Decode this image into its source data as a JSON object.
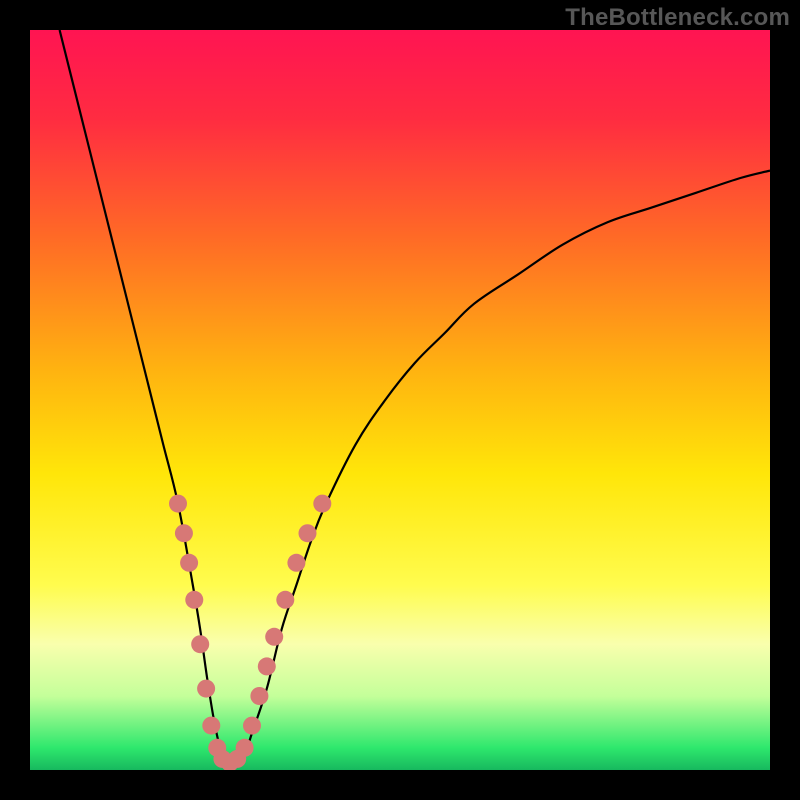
{
  "watermark": "TheBottleneck.com",
  "chart_data": {
    "type": "line",
    "title": "",
    "xlabel": "",
    "ylabel": "",
    "xlim": [
      0,
      100
    ],
    "ylim": [
      0,
      100
    ],
    "grid": false,
    "legend": false,
    "gradient_stops": [
      {
        "offset": 0.0,
        "color": "#ff1452"
      },
      {
        "offset": 0.12,
        "color": "#ff2c41"
      },
      {
        "offset": 0.28,
        "color": "#ff6a26"
      },
      {
        "offset": 0.46,
        "color": "#ffb310"
      },
      {
        "offset": 0.6,
        "color": "#ffe609"
      },
      {
        "offset": 0.75,
        "color": "#fffc4e"
      },
      {
        "offset": 0.83,
        "color": "#f9ffad"
      },
      {
        "offset": 0.9,
        "color": "#c4ff9a"
      },
      {
        "offset": 0.97,
        "color": "#2ee86d"
      },
      {
        "offset": 1.0,
        "color": "#17b85e"
      }
    ],
    "series": [
      {
        "name": "bottleneck-curve",
        "x": [
          4,
          6,
          8,
          10,
          12,
          14,
          16,
          18,
          20,
          22,
          23,
          24,
          25,
          26,
          27,
          28,
          29,
          30,
          32,
          34,
          36,
          38,
          40,
          44,
          48,
          52,
          56,
          60,
          66,
          72,
          78,
          84,
          90,
          96,
          100
        ],
        "y": [
          100,
          92,
          84,
          76,
          68,
          60,
          52,
          44,
          36,
          25,
          19,
          12,
          6,
          2,
          1,
          1,
          2,
          5,
          11,
          19,
          25,
          31,
          36,
          44,
          50,
          55,
          59,
          63,
          67,
          71,
          74,
          76,
          78,
          80,
          81
        ]
      }
    ],
    "dots": {
      "name": "highlight-dots",
      "points": [
        {
          "x": 20.0,
          "y": 36
        },
        {
          "x": 20.8,
          "y": 32
        },
        {
          "x": 21.5,
          "y": 28
        },
        {
          "x": 22.2,
          "y": 23
        },
        {
          "x": 23.0,
          "y": 17
        },
        {
          "x": 23.8,
          "y": 11
        },
        {
          "x": 24.5,
          "y": 6
        },
        {
          "x": 25.3,
          "y": 3
        },
        {
          "x": 26.0,
          "y": 1.5
        },
        {
          "x": 27.0,
          "y": 1
        },
        {
          "x": 28.0,
          "y": 1.5
        },
        {
          "x": 29.0,
          "y": 3
        },
        {
          "x": 30.0,
          "y": 6
        },
        {
          "x": 31.0,
          "y": 10
        },
        {
          "x": 32.0,
          "y": 14
        },
        {
          "x": 33.0,
          "y": 18
        },
        {
          "x": 34.5,
          "y": 23
        },
        {
          "x": 36.0,
          "y": 28
        },
        {
          "x": 37.5,
          "y": 32
        },
        {
          "x": 39.5,
          "y": 36
        }
      ]
    }
  }
}
